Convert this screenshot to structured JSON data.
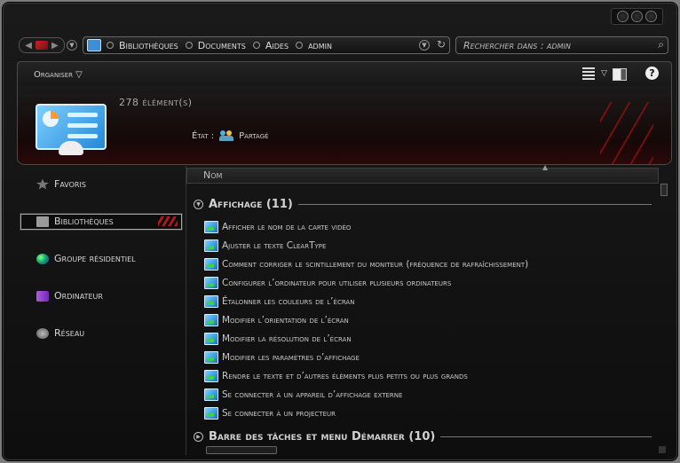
{
  "window": {
    "caption_buttons": [
      "minimize",
      "maximize",
      "close"
    ]
  },
  "nav": {
    "crumbs": [
      "Bibliothèques",
      "Documents",
      "Aides",
      "admin"
    ],
    "search_placeholder": "Rechercher dans : admin"
  },
  "toolbar": {
    "organise": "Organiser"
  },
  "header": {
    "count": "278 élément(s)",
    "state_label": "État :",
    "state_value": "Partagé"
  },
  "sidebar": {
    "items": [
      {
        "label": "Favoris",
        "icon": "star-icon"
      },
      {
        "label": "Bibliothèques",
        "icon": "library-icon",
        "selected": true
      },
      {
        "label": "Groupe résidentiel",
        "icon": "homegroup-icon"
      },
      {
        "label": "Ordinateur",
        "icon": "computer-icon"
      },
      {
        "label": "Réseau",
        "icon": "network-icon"
      }
    ]
  },
  "content": {
    "column": "Nom",
    "group1": {
      "title": "Affichage (11)",
      "expanded": true
    },
    "items": [
      "Afficher le nom de la carte vidéo",
      "Ajuster le texte ClearType",
      "Comment corriger le scintillement du moniteur (fréquence de rafraîchissement)",
      "Configurer l’ordinateur pour utiliser plusieurs ordinateurs",
      "Étalonner les couleurs de l’écran",
      "Modifier l’orientation de l’écran",
      "Modifier la résolution de l’écran",
      "Modifier les paramètres d’affichage",
      "Rendre le texte et d’autres éléments plus petits ou plus grands",
      "Se connecter à un appareil d’affichage externe",
      "Se connecter à un projecteur"
    ],
    "group2": {
      "title": "Barre des tâches et menu Démarrer (10)",
      "expanded": false
    }
  },
  "colors": {
    "accent": "#b31616",
    "background": "#101010",
    "text": "#c8c8c8"
  }
}
